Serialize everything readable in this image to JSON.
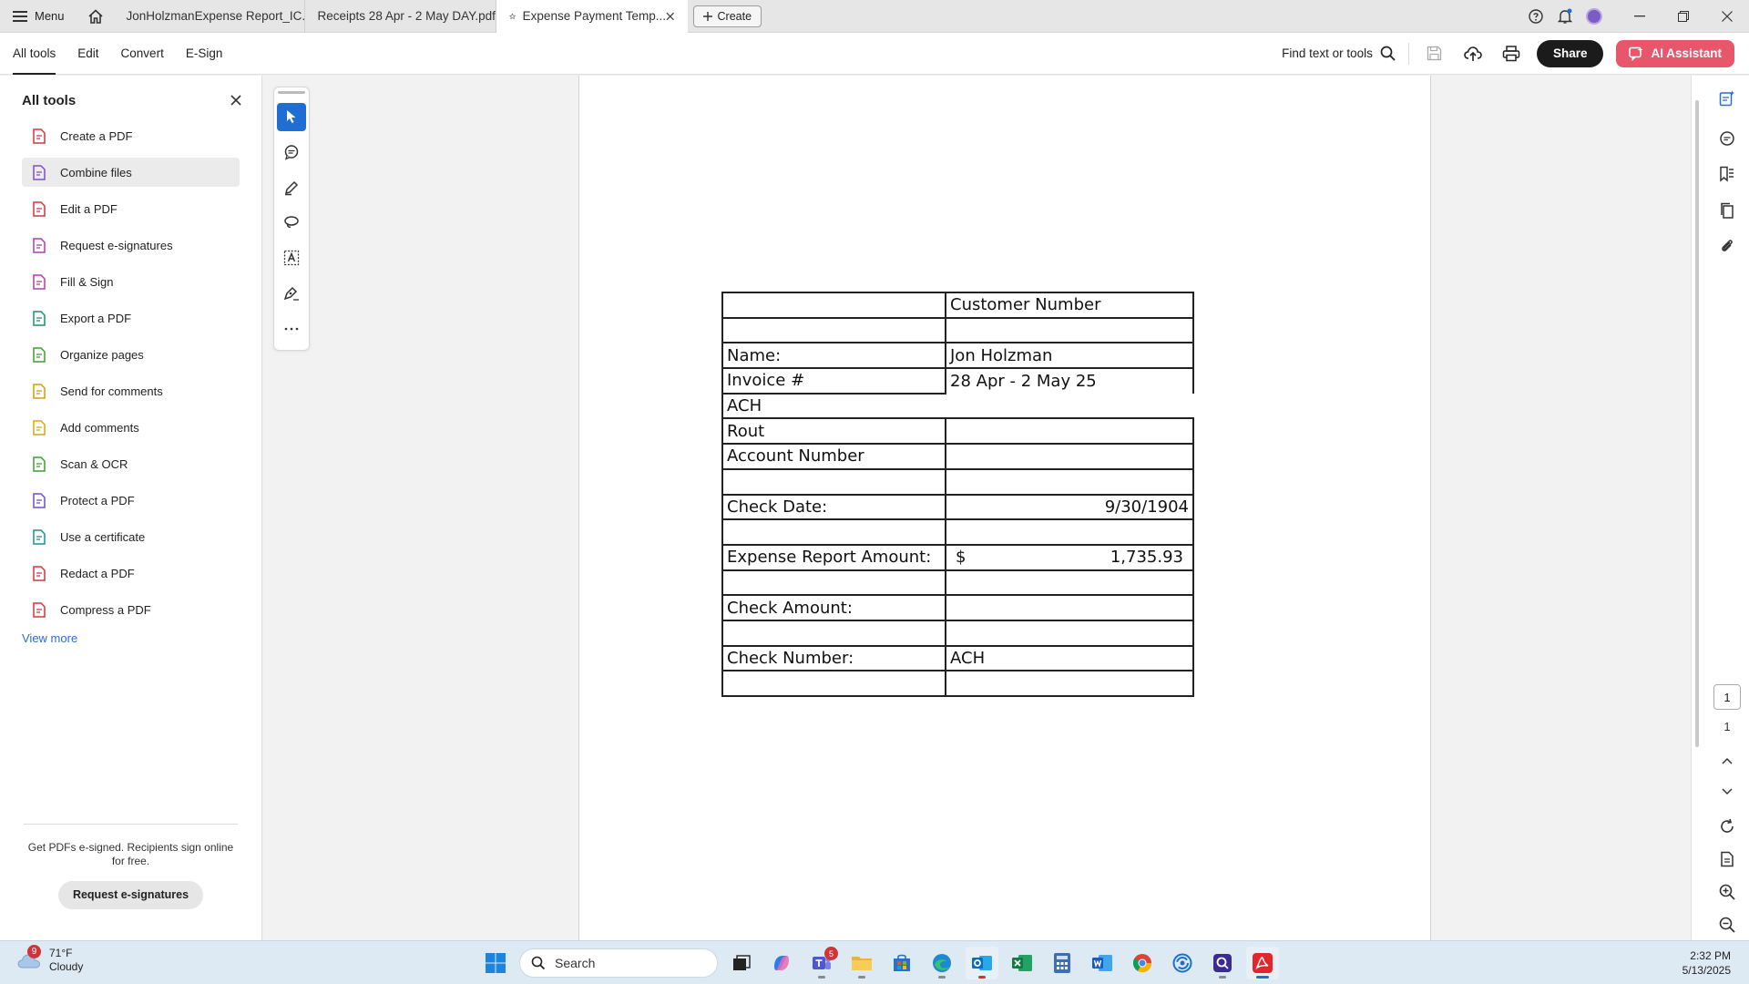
{
  "tabbar": {
    "menu_label": "Menu",
    "tabs": [
      {
        "label": "JonHolzmanExpense Report_IC..."
      },
      {
        "label": "Receipts 28 Apr - 2 May DAY.pdf"
      },
      {
        "label": "Expense Payment Temp..."
      }
    ],
    "create_label": "Create"
  },
  "toolbar": {
    "nav": [
      "All tools",
      "Edit",
      "Convert",
      "E-Sign"
    ],
    "find_label": "Find text or tools",
    "share_label": "Share",
    "ai_label": "AI Assistant"
  },
  "leftpanel": {
    "title": "All tools",
    "items": [
      {
        "label": "Create a PDF",
        "icon": "create-pdf-icon",
        "color": "#d6343d"
      },
      {
        "label": "Combine files",
        "icon": "combine-files-icon",
        "color": "#7b4fc9"
      },
      {
        "label": "Edit a PDF",
        "icon": "edit-pdf-icon",
        "color": "#d6343d"
      },
      {
        "label": "Request e-signatures",
        "icon": "request-esign-icon",
        "color": "#b03ca8"
      },
      {
        "label": "Fill & Sign",
        "icon": "fill-sign-icon",
        "color": "#b03ca8"
      },
      {
        "label": "Export a PDF",
        "icon": "export-pdf-icon",
        "color": "#1b8f6a"
      },
      {
        "label": "Organize pages",
        "icon": "organize-pages-icon",
        "color": "#3f9e2f"
      },
      {
        "label": "Send for comments",
        "icon": "send-comments-icon",
        "color": "#d89a0a"
      },
      {
        "label": "Add comments",
        "icon": "add-comments-icon",
        "color": "#d8a70a"
      },
      {
        "label": "Scan & OCR",
        "icon": "scan-ocr-icon",
        "color": "#3f9e2f"
      },
      {
        "label": "Protect a PDF",
        "icon": "protect-pdf-icon",
        "color": "#6b4fc9"
      },
      {
        "label": "Use a certificate",
        "icon": "certificate-icon",
        "color": "#1b8f8f"
      },
      {
        "label": "Redact a PDF",
        "icon": "redact-pdf-icon",
        "color": "#d6343d"
      },
      {
        "label": "Compress a PDF",
        "icon": "compress-pdf-icon",
        "color": "#d6343d"
      }
    ],
    "view_more": "View more",
    "promo_text": "Get PDFs e-signed. Recipients sign online for free.",
    "promo_button": "Request e-signatures"
  },
  "form": {
    "customer_number": "Customer Number",
    "name_label": "Name:",
    "name_value": "Jon Holzman",
    "invoice_label": "Invoice #",
    "invoice_value": "28 Apr - 2 May 25",
    "ach_label": "ACH",
    "rout_label": "Rout",
    "account_label": "Account Number",
    "check_date_label": "Check Date:",
    "check_date_value": "9/30/1904",
    "expense_label": "Expense Report Amount:",
    "currency": "$",
    "expense_value": "1,735.93",
    "check_amount_label": "Check Amount:",
    "check_number_label": "Check Number:",
    "check_number_value": "ACH"
  },
  "pager": {
    "current": "1",
    "total": "1"
  },
  "taskbar": {
    "weather_temp": "71°F",
    "weather_desc": "Cloudy",
    "weather_badge": "9",
    "search_label": "Search",
    "teams_badge": "5",
    "time": "2:32 PM",
    "date": "5/13/2025"
  }
}
